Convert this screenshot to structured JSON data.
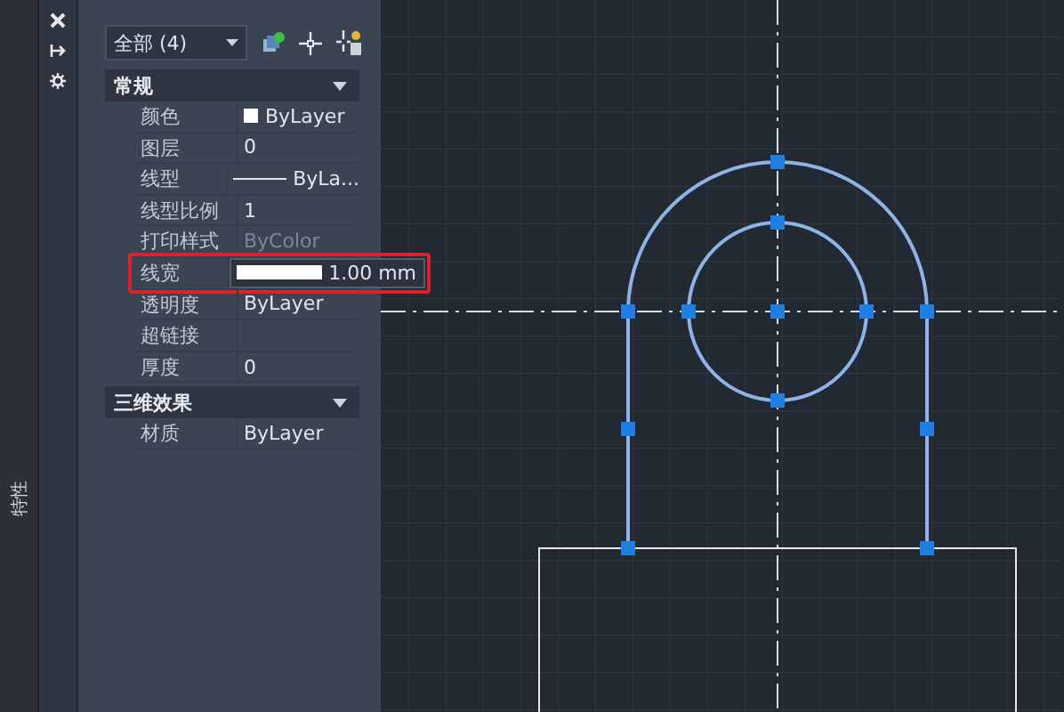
{
  "palette_title": "特性",
  "filter": {
    "value": "全部 (4)"
  },
  "sections": [
    {
      "title": "常规",
      "expanded": true,
      "rows": [
        {
          "kind": "color",
          "label": "颜色",
          "value": "ByLayer",
          "disabled": false,
          "highlighted": false
        },
        {
          "kind": "text",
          "label": "图层",
          "value": "0",
          "disabled": false,
          "highlighted": false
        },
        {
          "kind": "linetype",
          "label": "线型",
          "value": "ByLa...",
          "disabled": false,
          "highlighted": false
        },
        {
          "kind": "text",
          "label": "线型比例",
          "value": "1",
          "disabled": false,
          "highlighted": false
        },
        {
          "kind": "text",
          "label": "打印样式",
          "value": "ByColor",
          "disabled": true,
          "highlighted": false
        },
        {
          "kind": "lineweight",
          "label": "线宽",
          "value": "1.00 mm",
          "disabled": false,
          "highlighted": true
        },
        {
          "kind": "text",
          "label": "透明度",
          "value": "ByLayer",
          "disabled": false,
          "highlighted": false
        },
        {
          "kind": "text",
          "label": "超链接",
          "disabled": false,
          "highlighted": false
        },
        {
          "kind": "text",
          "label": "厚度",
          "value": "0",
          "disabled": false,
          "highlighted": false
        }
      ]
    },
    {
      "title": "三维效果",
      "expanded": true,
      "rows": [
        {
          "kind": "text",
          "label": "材质",
          "value": "ByLayer",
          "disabled": false,
          "highlighted": false
        }
      ]
    }
  ]
}
